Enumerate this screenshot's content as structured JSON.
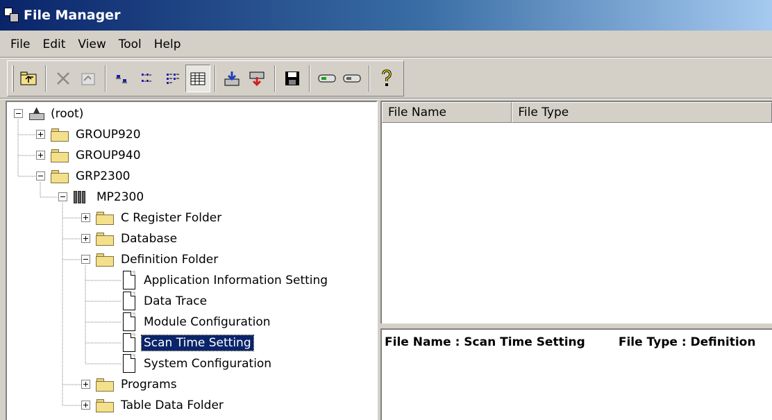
{
  "window": {
    "title": "File Manager"
  },
  "menu": [
    "File",
    "Edit",
    "View",
    "Tool",
    "Help"
  ],
  "toolbar": {
    "buttons": [
      {
        "name": "up-folder-icon"
      },
      {
        "name": "delete-icon",
        "disabled": true
      },
      {
        "name": "properties-icon",
        "disabled": true
      },
      {
        "name": "large-icons-icon"
      },
      {
        "name": "small-icons-icon"
      },
      {
        "name": "list-view-icon"
      },
      {
        "name": "details-view-icon",
        "pressed": true
      },
      {
        "name": "import-icon"
      },
      {
        "name": "export-icon"
      },
      {
        "name": "save-icon"
      },
      {
        "name": "online-icon"
      },
      {
        "name": "offline-icon"
      },
      {
        "name": "help-icon"
      }
    ]
  },
  "tree": {
    "nodes": [
      {
        "label": "(root)",
        "type": "root",
        "expander": "minus"
      },
      {
        "label": "GROUP920",
        "type": "folder",
        "expander": "plus"
      },
      {
        "label": "GROUP940",
        "type": "folder",
        "expander": "plus"
      },
      {
        "label": "GRP2300",
        "type": "folder",
        "expander": "minus"
      },
      {
        "label": "MP2300",
        "type": "device",
        "expander": "minus"
      },
      {
        "label": "C Register Folder",
        "type": "folder",
        "expander": "plus"
      },
      {
        "label": "Database",
        "type": "folder",
        "expander": "plus"
      },
      {
        "label": "Definition Folder",
        "type": "folder",
        "expander": "minus"
      },
      {
        "label": "Application Information Setting",
        "type": "document"
      },
      {
        "label": "Data Trace",
        "type": "document"
      },
      {
        "label": "Module Configuration",
        "type": "document"
      },
      {
        "label": "Scan Time Setting",
        "type": "document",
        "selected": true
      },
      {
        "label": "System Configuration",
        "type": "document"
      },
      {
        "label": "Programs",
        "type": "folder",
        "expander": "plus"
      },
      {
        "label": "Table Data Folder",
        "type": "folder",
        "expander": "plus"
      }
    ]
  },
  "list": {
    "columns": [
      "File Name",
      "File Type"
    ]
  },
  "detail": {
    "file_name": "File Name : Scan Time Setting",
    "file_type": "File Type : Definition"
  },
  "colors": {
    "titlebar_start": "#0a246a",
    "titlebar_end": "#a6caf0",
    "selection": "#0a246a",
    "chrome": "#d4d0c8"
  }
}
